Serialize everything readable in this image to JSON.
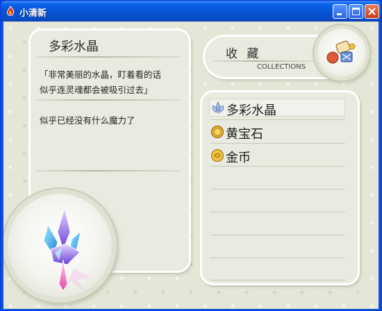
{
  "window": {
    "title": "小清新",
    "icon": "app-flame-icon",
    "controls": [
      "minimize-icon",
      "maximize-icon",
      "close-icon"
    ]
  },
  "item_detail": {
    "name": "多彩水晶",
    "quote_line1": "「非常美丽的水晶，盯着看的话",
    "quote_line2": "似乎连灵魂都会被吸引过去」",
    "description": "似乎已经没有什么魔力了",
    "image": "crystal-cluster-image"
  },
  "collections": {
    "title": "收 藏",
    "subtitle": "COLLECTIONS",
    "icon": "collection-toys-icon",
    "items": [
      {
        "label": "多彩水晶",
        "icon": "crystal-icon",
        "selected": true
      },
      {
        "label": "黄宝石",
        "icon": "topaz-coin-icon",
        "selected": false
      },
      {
        "label": "金币",
        "icon": "gold-coin-icon",
        "selected": false
      }
    ]
  },
  "colors": {
    "titlebar": "#0553d4",
    "panel": "#e9ebe0",
    "background": "#e4e7d7"
  }
}
